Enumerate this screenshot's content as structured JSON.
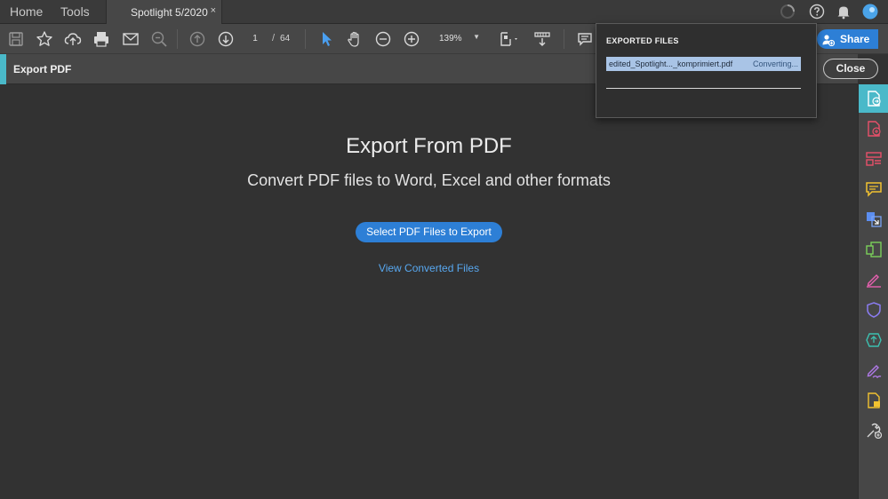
{
  "tabbar": {
    "home": "Home",
    "tools": "Tools",
    "doc_tab": "Spotlight 5/2020",
    "close_glyph": "×"
  },
  "toolbar": {
    "page_current": "1",
    "page_sep": "/",
    "page_total": "64",
    "zoom": "139%",
    "zoom_arrow": "▼"
  },
  "share": {
    "label": "Share"
  },
  "subheader": {
    "title": "Export PDF",
    "close_label": "Close"
  },
  "main": {
    "heading": "Export From PDF",
    "subheading": "Convert PDF files to Word, Excel and other formats",
    "select_button": "Select PDF Files to Export",
    "view_link": "View Converted Files"
  },
  "popover": {
    "header": "EXPORTED FILES",
    "file_name": "edited_Spotlight..._komprimiert.pdf",
    "file_status": "Converting..."
  },
  "colors": {
    "accent_teal": "#4ab9c9",
    "primary_blue": "#2d7fd6",
    "link_blue": "#58a8f0"
  }
}
